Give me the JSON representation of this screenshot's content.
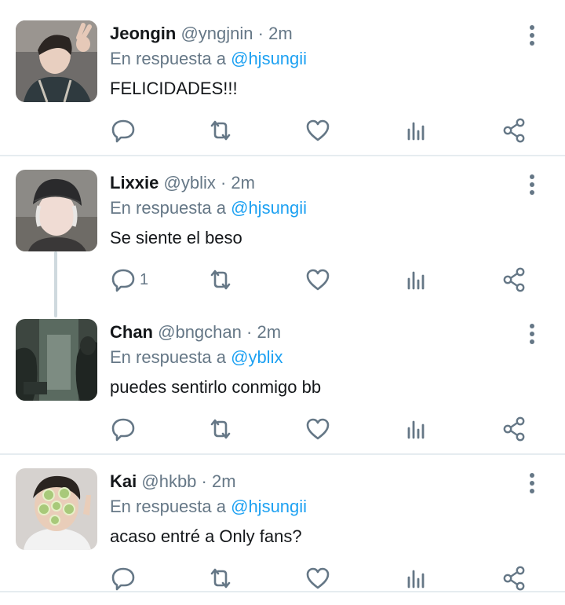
{
  "reply_prefix": "En respuesta a",
  "colors": {
    "link": "#1da1f2",
    "muted": "#657786",
    "icon": "#657786",
    "divider": "#e6ecf0"
  },
  "icons": [
    "reply-icon",
    "retweet-icon",
    "like-icon",
    "stats-icon",
    "share-icon",
    "more-options-icon"
  ],
  "tweets": [
    {
      "name": "Jeongin",
      "handle": "@yngjnin",
      "time": "2m",
      "reply_to": "@hjsungii",
      "text": "FELICIDADES!!!",
      "reply_count": ""
    },
    {
      "name": "Lixxie",
      "handle": "@yblix",
      "time": "2m",
      "reply_to": "@hjsungii",
      "text": "Se siente el beso",
      "reply_count": "1"
    },
    {
      "name": "Chan",
      "handle": "@bngchan",
      "time": "2m",
      "reply_to": "@yblix",
      "text": "puedes sentirlo conmigo bb",
      "reply_count": ""
    },
    {
      "name": "Kai",
      "handle": "@hkbb",
      "time": "2m",
      "reply_to": "@hjsungii",
      "text": "acaso entré a Only fans?",
      "reply_count": ""
    }
  ]
}
